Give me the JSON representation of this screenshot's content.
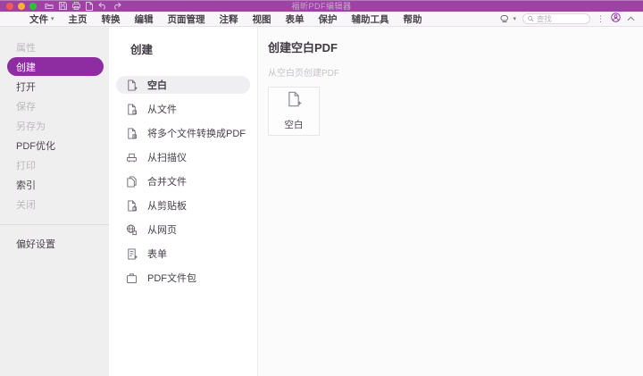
{
  "window": {
    "title": "福昕PDF编辑器",
    "traffic_lights": [
      "close",
      "minimize",
      "zoom"
    ],
    "quick_access_icons": [
      "open-folder-icon",
      "save-icon",
      "print-icon",
      "new-document-icon",
      "undo-icon",
      "redo-icon"
    ]
  },
  "menu_bar": {
    "items": [
      {
        "label": "文件",
        "has_dropdown": true
      },
      {
        "label": "主页"
      },
      {
        "label": "转换"
      },
      {
        "label": "编辑"
      },
      {
        "label": "页面管理"
      },
      {
        "label": "注释"
      },
      {
        "label": "视图"
      },
      {
        "label": "表单"
      },
      {
        "label": "保护"
      },
      {
        "label": "辅助工具"
      },
      {
        "label": "帮助"
      }
    ],
    "right_icons": [
      "tool-selector-icon",
      "more-options-icon",
      "account-icon",
      "collapse-ribbon-icon"
    ],
    "search": {
      "placeholder": "查找",
      "icon": "search-icon"
    }
  },
  "sidebar": {
    "items": [
      {
        "label": "属性",
        "state": "disabled"
      },
      {
        "label": "创建",
        "state": "selected"
      },
      {
        "label": "打开",
        "state": "enabled"
      },
      {
        "label": "保存",
        "state": "disabled"
      },
      {
        "label": "另存为",
        "state": "disabled"
      },
      {
        "label": "PDF优化",
        "state": "enabled"
      },
      {
        "label": "打印",
        "state": "disabled"
      },
      {
        "label": "索引",
        "state": "enabled"
      },
      {
        "label": "关闭",
        "state": "disabled"
      }
    ],
    "preferences_label": "偏好设置"
  },
  "create_panel": {
    "title": "创建",
    "items": [
      {
        "label": "空白",
        "icon": "blank-document-plus-icon",
        "selected": true
      },
      {
        "label": "从文件",
        "icon": "document-from-file-icon"
      },
      {
        "label": "将多个文件转换成PDF",
        "icon": "multiple-files-to-pdf-icon"
      },
      {
        "label": "从扫描仪",
        "icon": "scanner-icon"
      },
      {
        "label": "合并文件",
        "icon": "combine-files-icon"
      },
      {
        "label": "从剪贴板",
        "icon": "clipboard-icon"
      },
      {
        "label": "从网页",
        "icon": "webpage-icon"
      },
      {
        "label": "表单",
        "icon": "form-document-icon"
      },
      {
        "label": "PDF文件包",
        "icon": "pdf-portfolio-icon"
      }
    ]
  },
  "content": {
    "title": "创建空白PDF",
    "subtitle": "从空白页创建PDF",
    "card": {
      "label": "空白",
      "icon": "blank-document-plus-icon"
    }
  },
  "colors": {
    "titlebar": "#9c43a3",
    "accent": "#8e2da2",
    "sidebar_bg": "#f0eff0",
    "selected_row_bg": "#efeef0",
    "disabled_text": "#bcb9bd"
  }
}
